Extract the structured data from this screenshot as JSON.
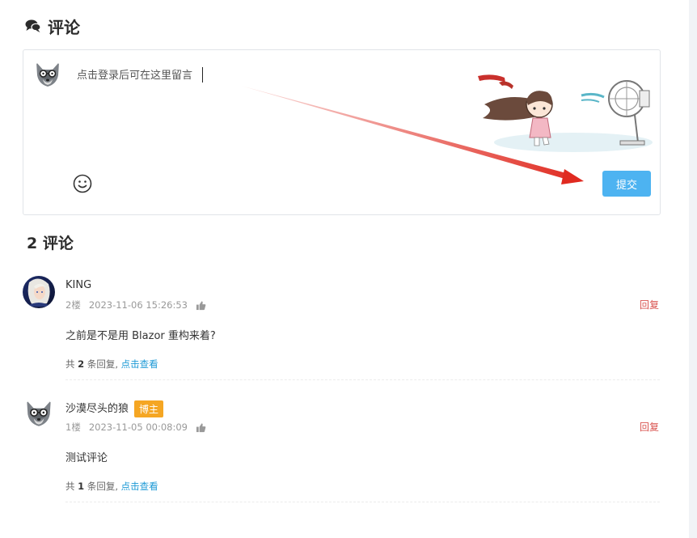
{
  "header": {
    "title": "评论",
    "icon": "chat-bubbles-icon"
  },
  "comment_box": {
    "placeholder": "点击登录后可在这里留言",
    "submit_label": "提交",
    "emoji_icon": "smiley-icon"
  },
  "comments_section": {
    "count_title": "2 评论"
  },
  "comments": [
    {
      "author": "KING",
      "badge": "",
      "floor": "2楼",
      "time": "2023-11-06 15:26:53",
      "text": "之前是不是用 Blazor 重构来着?",
      "reply_label": "回复",
      "replies_prefix": "共",
      "replies_count": "2",
      "replies_suffix": "条回复,",
      "view_label": "点击查看"
    },
    {
      "author": "沙漠尽头的狼",
      "badge": "博主",
      "floor": "1楼",
      "time": "2023-11-05 00:08:09",
      "text": "测试评论",
      "reply_label": "回复",
      "replies_prefix": "共",
      "replies_count": "1",
      "replies_suffix": "条回复,",
      "view_label": "点击查看"
    }
  ],
  "colors": {
    "submit_button": "#4db3f1",
    "reply_link": "#d9534f",
    "view_link": "#1e9ad6",
    "badge": "#f5a623",
    "annotation_arrow": "#e02a20"
  }
}
